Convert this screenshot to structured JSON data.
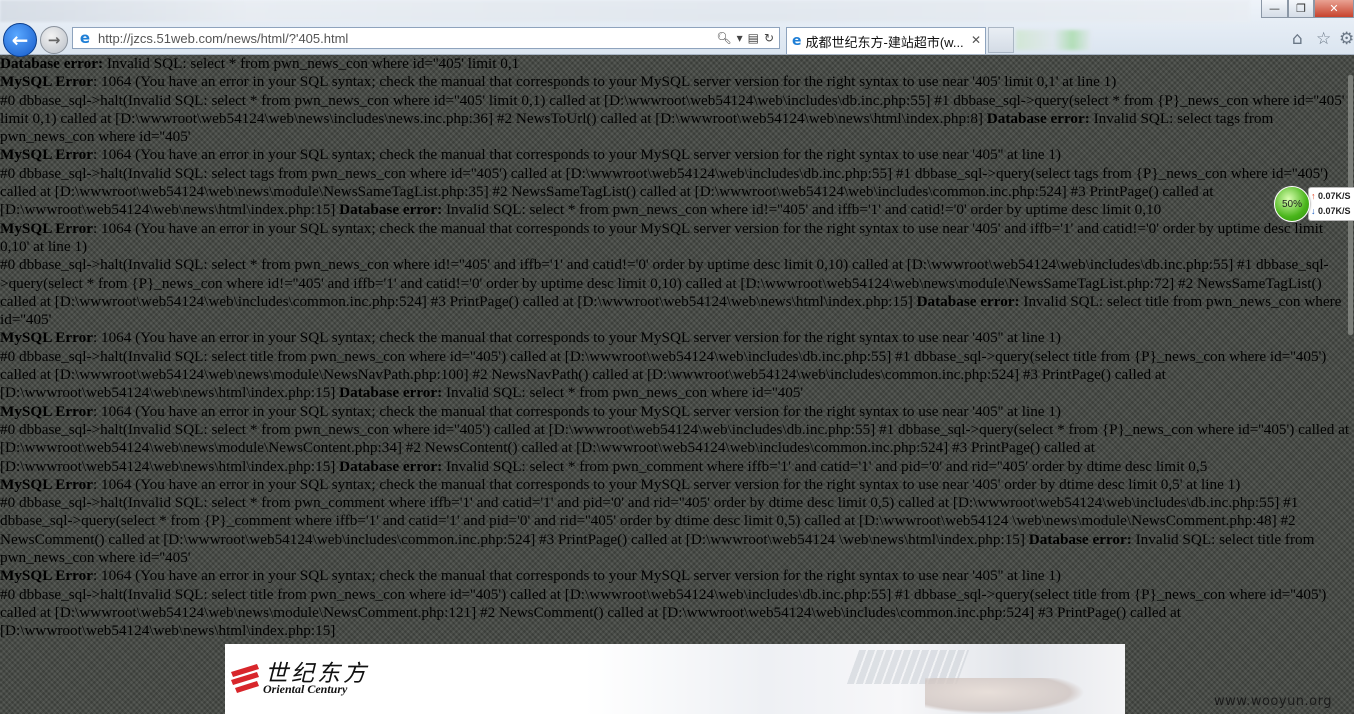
{
  "browser": {
    "url": "http://jzcs.51web.com/news/html/?'405.html",
    "tab_title": "成都世纪东方-建站超市(w...",
    "tab_close_icon": "close-icon",
    "window_close": "✕",
    "window_maximize": "❐",
    "window_minimize": "—"
  },
  "net_meter": {
    "percent": "50%",
    "upload": "0.07K/S",
    "download": "0.07K/S"
  },
  "content": {
    "p1_label": "Database error:",
    "p1_text": " Invalid SQL: select * from pwn_news_con where id=''405' limit 0,1",
    "p2_label": "MySQL Error",
    "p2_text": ": 1064 (You have an error in your SQL syntax; check the manual that corresponds to your MySQL server version for the right syntax to use near '405' limit 0,1' at line 1)",
    "p3_text": "#0 dbbase_sql->halt(Invalid SQL: select * from pwn_news_con where id=''405' limit 0,1) called at [D:\\wwwroot\\web54124\\web\\includes\\db.inc.php:55] #1 dbbase_sql->query(select * from {P}_news_con where id=''405' limit 0,1) called at [D:\\wwwroot\\web54124\\web\\news\\includes\\news.inc.php:36] #2 NewsToUrl() called at [D:\\wwwroot\\web54124\\web\\news\\html\\index.php:8] ",
    "p3_label": "Database error:",
    "p3_tail": " Invalid SQL: select tags from pwn_news_con where id=''405'",
    "p4_label": "MySQL Error",
    "p4_text": ": 1064 (You have an error in your SQL syntax; check the manual that corresponds to your MySQL server version for the right syntax to use near '405'' at line 1)",
    "p5_text": "#0 dbbase_sql->halt(Invalid SQL: select tags from pwn_news_con where id=''405') called at [D:\\wwwroot\\web54124\\web\\includes\\db.inc.php:55] #1 dbbase_sql->query(select tags from {P}_news_con where id=''405') called at [D:\\wwwroot\\web54124\\web\\news\\module\\NewsSameTagList.php:35] #2 NewsSameTagList() called at [D:\\wwwroot\\web54124\\web\\includes\\common.inc.php:524] #3 PrintPage() called at [D:\\wwwroot\\web54124\\web\\news\\html\\index.php:15] ",
    "p5_label": "Database error:",
    "p5_tail": " Invalid SQL: select * from pwn_news_con where id!=''405' and iffb='1' and catid!='0' order by uptime desc limit 0,10",
    "p6_label": "MySQL Error",
    "p6_text": ": 1064 (You have an error in your SQL syntax; check the manual that corresponds to your MySQL server version for the right syntax to use near '405' and iffb='1' and catid!='0' order by uptime desc limit 0,10' at line 1)",
    "p7_text": "#0 dbbase_sql->halt(Invalid SQL: select * from pwn_news_con where id!=''405' and iffb='1' and catid!='0' order by uptime desc limit 0,10) called at [D:\\wwwroot\\web54124\\web\\includes\\db.inc.php:55] #1 dbbase_sql->query(select * from {P}_news_con where id!=''405' and iffb='1' and catid!='0' order by uptime desc limit 0,10) called at [D:\\wwwroot\\web54124\\web\\news\\module\\NewsSameTagList.php:72] #2 NewsSameTagList() called at [D:\\wwwroot\\web54124\\web\\includes\\common.inc.php:524] #3 PrintPage() called at [D:\\wwwroot\\web54124\\web\\news\\html\\index.php:15] ",
    "p7_label": "Database error:",
    "p7_tail": " Invalid SQL: select title from pwn_news_con where id=''405'",
    "p8_label": "MySQL Error",
    "p8_text": ": 1064 (You have an error in your SQL syntax; check the manual that corresponds to your MySQL server version for the right syntax to use near '405'' at line 1)",
    "p9_text": "#0 dbbase_sql->halt(Invalid SQL: select title from pwn_news_con where id=''405') called at [D:\\wwwroot\\web54124\\web\\includes\\db.inc.php:55] #1 dbbase_sql->query(select title from {P}_news_con where id=''405') called at [D:\\wwwroot\\web54124\\web\\news\\module\\NewsNavPath.php:100] #2 NewsNavPath() called at [D:\\wwwroot\\web54124\\web\\includes\\common.inc.php:524] #3 PrintPage() called at [D:\\wwwroot\\web54124\\web\\news\\html\\index.php:15] ",
    "p9_label": "Database error:",
    "p9_tail": " Invalid SQL: select * from pwn_news_con where id=''405'",
    "p10_label": "MySQL Error",
    "p10_text": ": 1064 (You have an error in your SQL syntax; check the manual that corresponds to your MySQL server version for the right syntax to use near '405'' at line 1)",
    "p11_text": "#0 dbbase_sql->halt(Invalid SQL: select * from pwn_news_con where id=''405') called at [D:\\wwwroot\\web54124\\web\\includes\\db.inc.php:55] #1 dbbase_sql->query(select * from {P}_news_con where id=''405') called at [D:\\wwwroot\\web54124\\web\\news\\module\\NewsContent.php:34] #2 NewsContent() called at [D:\\wwwroot\\web54124\\web\\includes\\common.inc.php:524] #3 PrintPage() called at [D:\\wwwroot\\web54124\\web\\news\\html\\index.php:15] ",
    "p11_label": "Database error:",
    "p11_tail": " Invalid SQL: select * from pwn_comment where iffb='1' and catid='1' and pid='0' and rid=''405' order by dtime desc limit 0,5",
    "p12_label": "MySQL Error",
    "p12_text": ": 1064 (You have an error in your SQL syntax; check the manual that corresponds to your MySQL server version for the right syntax to use near '405' order by dtime desc limit 0,5' at line 1)",
    "p13_text": "#0 dbbase_sql->halt(Invalid SQL: select * from pwn_comment where iffb='1' and catid='1' and pid='0' and rid=''405' order by dtime desc limit 0,5) called at [D:\\wwwroot\\web54124\\web\\includes\\db.inc.php:55] #1 dbbase_sql->query(select * from {P}_comment where iffb='1' and catid='1' and pid='0' and rid=''405' order by dtime desc limit 0,5) called at [D:\\wwwroot\\web54124 \\web\\news\\module\\NewsComment.php:48] #2 NewsComment() called at [D:\\wwwroot\\web54124\\web\\includes\\common.inc.php:524] #3 PrintPage() called at [D:\\wwwroot\\web54124 \\web\\news\\html\\index.php:15] ",
    "p13_label": "Database error:",
    "p13_tail": " Invalid SQL: select title from pwn_news_con where id=''405'",
    "p14_label": "MySQL Error",
    "p14_text": ": 1064 (You have an error in your SQL syntax; check the manual that corresponds to your MySQL server version for the right syntax to use near '405'' at line 1)",
    "p15_text": "#0 dbbase_sql->halt(Invalid SQL: select title from pwn_news_con where id=''405') called at [D:\\wwwroot\\web54124\\web\\includes\\db.inc.php:55] #1 dbbase_sql->query(select title from {P}_news_con where id=''405') called at [D:\\wwwroot\\web54124\\web\\news\\module\\NewsComment.php:121] #2 NewsComment() called at [D:\\wwwroot\\web54124\\web\\includes\\common.inc.php:524] #3 PrintPage() called at [D:\\wwwroot\\web54124\\web\\news\\html\\index.php:15]"
  },
  "banner": {
    "logo_cn": "世纪东方",
    "logo_en": "Oriental Century"
  },
  "watermark": "www.wooyun.org",
  "icons": {
    "back": "back-arrow-icon",
    "forward": "forward-arrow-icon",
    "search": "search-icon",
    "refresh": "refresh-icon",
    "home": "home-icon",
    "favorites": "star-icon",
    "tools": "gear-icon"
  }
}
